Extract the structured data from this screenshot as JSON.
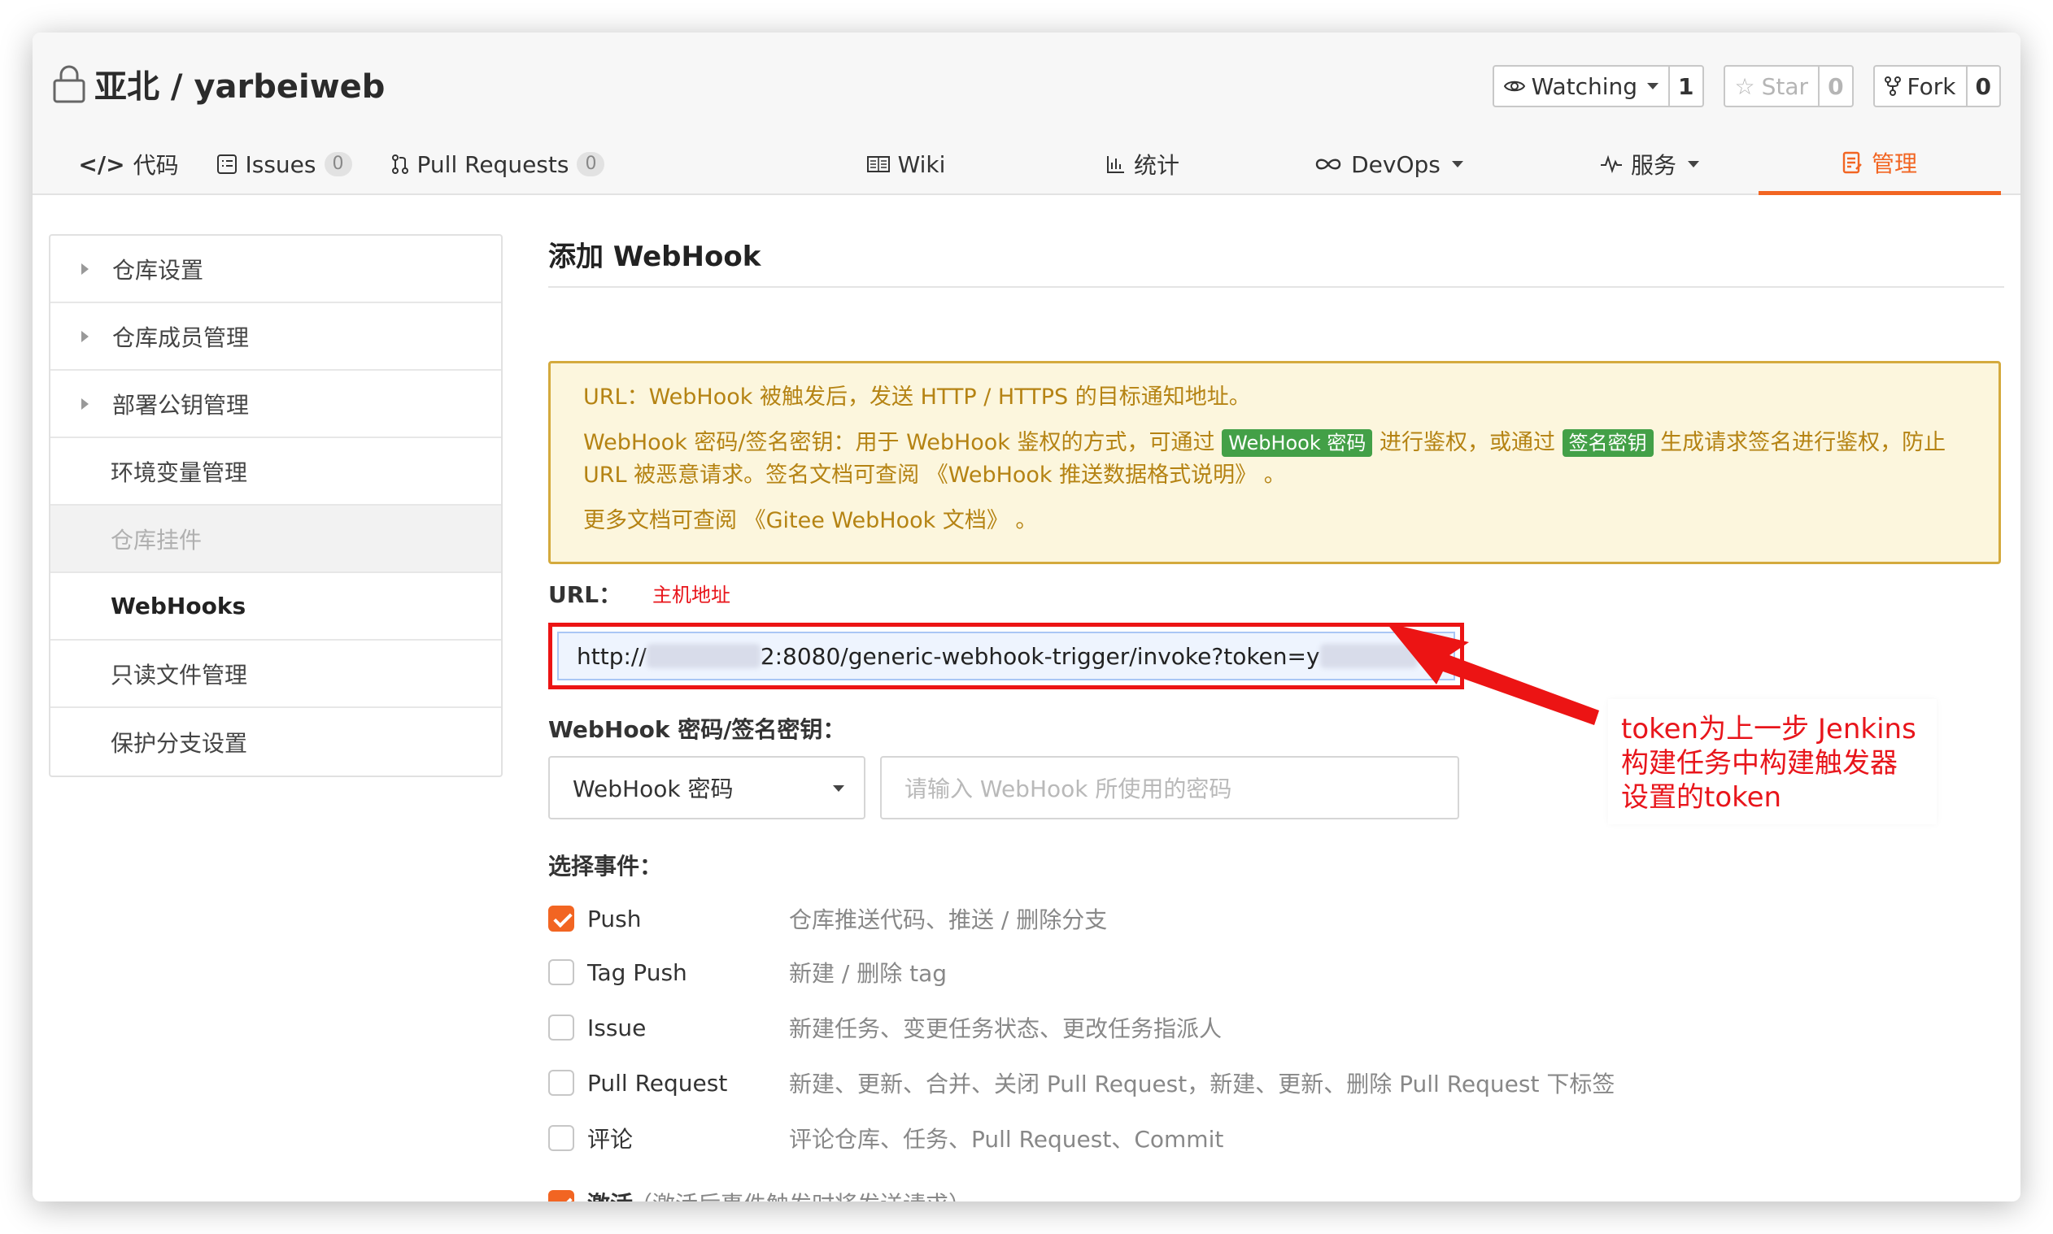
{
  "repo": {
    "title": "亚北 / yarbeiweb"
  },
  "actions": {
    "watch": {
      "label": "Watching",
      "count": "1"
    },
    "star": {
      "label": "Star",
      "count": "0"
    },
    "fork": {
      "label": "Fork",
      "count": "0"
    }
  },
  "tabs": [
    {
      "label": "代码",
      "icon": "code-icon"
    },
    {
      "label": "Issues",
      "badge": "0",
      "icon": "issues-icon"
    },
    {
      "label": "Pull Requests",
      "badge": "0",
      "icon": "pull-request-icon"
    },
    {
      "label": "Wiki",
      "icon": "wiki-icon"
    },
    {
      "label": "统计",
      "icon": "stats-icon"
    },
    {
      "label": "DevOps",
      "icon": "infinity-icon"
    },
    {
      "label": "服务",
      "icon": "pulse-icon"
    },
    {
      "label": "管理",
      "icon": "manage-icon"
    }
  ],
  "sidebar": {
    "items": [
      {
        "label": "仓库设置"
      },
      {
        "label": "仓库成员管理"
      },
      {
        "label": "部署公钥管理"
      },
      {
        "label": "环境变量管理"
      },
      {
        "label": "仓库挂件"
      },
      {
        "label": "WebHooks"
      },
      {
        "label": "只读文件管理"
      },
      {
        "label": "保护分支设置"
      }
    ]
  },
  "main": {
    "title": "添加 WebHook",
    "notice": {
      "line1": "URL：WebHook 被触发后，发送 HTTP / HTTPS 的目标通知地址。",
      "line2_a": "WebHook 密码/签名密钥：用于 WebHook 鉴权的方式，可通过",
      "tag1": "WebHook 密码",
      "line2_b": "进行鉴权，或通过",
      "tag2": "签名密钥",
      "line2_c": "生成请求签名进行鉴权，防止 URL 被恶意请求。签名文档可查阅 《WebHook 推送数据格式说明》 。",
      "line3": "更多文档可查阅 《Gitee WebHook 文档》 。"
    },
    "url_label": "URL：",
    "url_note": "主机地址",
    "url_prefix": "http://",
    "url_middle": "2:8080/generic-webhook-trigger/invoke?token=y",
    "secret_label": "WebHook 密码/签名密钥：",
    "secret_select": "WebHook 密码",
    "secret_placeholder": "请输入 WebHook 所使用的密码",
    "events_label": "选择事件：",
    "events": [
      {
        "name": "Push",
        "desc": "仓库推送代码、推送 / 删除分支",
        "checked": true
      },
      {
        "name": "Tag Push",
        "desc": "新建 / 删除 tag",
        "checked": false
      },
      {
        "name": "Issue",
        "desc": "新建任务、变更任务状态、更改任务指派人",
        "checked": false
      },
      {
        "name": "Pull Request",
        "desc": "新建、更新、合并、关闭 Pull Request，新建、更新、删除 Pull Request 下标签",
        "checked": false
      },
      {
        "name": "评论",
        "desc": "评论仓库、任务、Pull Request、Commit",
        "checked": false
      }
    ],
    "activate": {
      "name": "激活",
      "hint": "（激活后事件触发时将发送请求）",
      "checked": true
    }
  },
  "annotation": {
    "line1": "token为上一步 Jenkins",
    "line2": "构建任务中构建触发器",
    "line3": "设置的token"
  },
  "colors": {
    "accent": "#f26522",
    "annotation_red": "#e8151b",
    "notice_bg": "#fcf6dd",
    "tag_green": "#43a047"
  }
}
